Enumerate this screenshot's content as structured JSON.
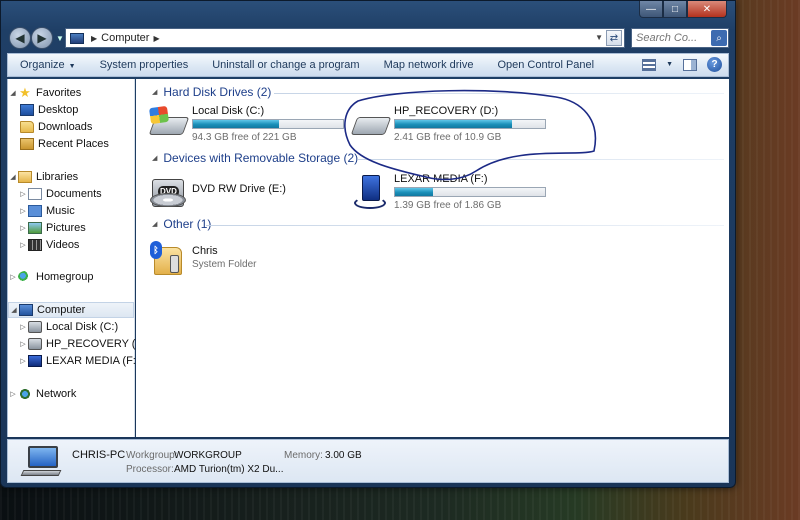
{
  "window": {
    "caption": {
      "minimize": "—",
      "maximize": "□",
      "close": "✕"
    }
  },
  "address": {
    "crumbs": [
      "Computer"
    ],
    "search_placeholder": "Search Co..."
  },
  "toolbar": {
    "items": [
      "Organize",
      "System properties",
      "Uninstall or change a program",
      "Map network drive",
      "Open Control Panel"
    ]
  },
  "nav": {
    "favorites": "Favorites",
    "favorites_items": [
      "Desktop",
      "Downloads",
      "Recent Places"
    ],
    "libraries": "Libraries",
    "libraries_items": [
      "Documents",
      "Music",
      "Pictures",
      "Videos"
    ],
    "homegroup": "Homegroup",
    "computer": "Computer",
    "computer_items": [
      "Local Disk (C:)",
      "HP_RECOVERY (D:)",
      "LEXAR MEDIA (F:)"
    ],
    "network": "Network"
  },
  "groups": {
    "hard_disk": "Hard Disk Drives (2)",
    "removable": "Devices with Removable Storage (2)",
    "other": "Other (1)"
  },
  "drives": {
    "c": {
      "name": "Local Disk (C:)",
      "free": "94.3 GB free of 221 GB",
      "used_fraction": 0.573
    },
    "d": {
      "name": "HP_RECOVERY (D:)",
      "free": "2.41 GB free of 10.9 GB",
      "used_fraction": 0.779
    },
    "e": {
      "name": "DVD RW Drive (E:)"
    },
    "f": {
      "name": "LEXAR MEDIA (F:)",
      "free": "1.39 GB free of 1.86 GB",
      "used_fraction": 0.253
    }
  },
  "other_items": {
    "chris": {
      "name": "Chris",
      "type": "System Folder"
    }
  },
  "details": {
    "computer_name": "CHRIS-PC",
    "workgroup_label": "Workgroup:",
    "workgroup": "WORKGROUP",
    "memory_label": "Memory:",
    "memory": "3.00 GB",
    "processor_label": "Processor:",
    "processor": "AMD Turion(tm) X2 Du..."
  },
  "colors": {
    "accent": "#1e3f8a",
    "bar_fill": "#1a8fb8",
    "annotation": "#1c2a86"
  }
}
